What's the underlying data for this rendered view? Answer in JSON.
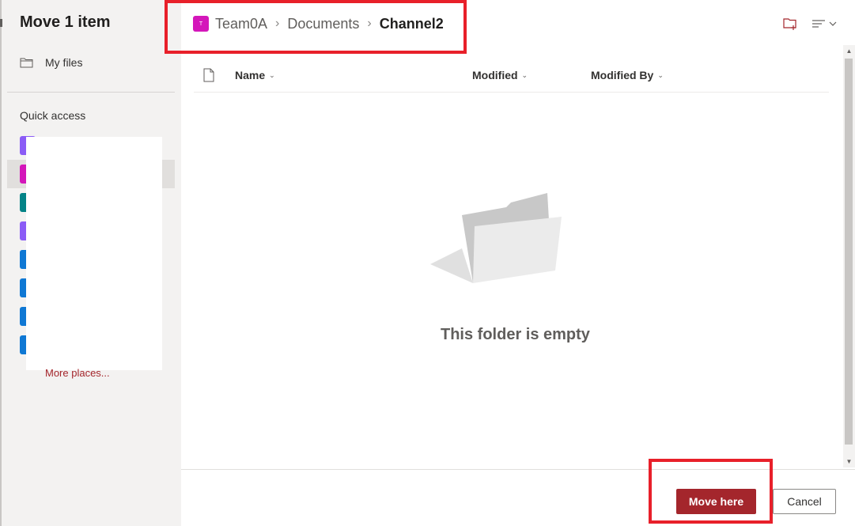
{
  "panel": {
    "title": "Move 1 item"
  },
  "sidebar": {
    "my_files_label": "My files",
    "quick_access_heading": "Quick access",
    "quick_access_items": [
      {
        "color": "#8b5cf6"
      },
      {
        "color": "#d417ba",
        "selected": true
      },
      {
        "color": "#038387"
      },
      {
        "color": "#8b5cf6"
      },
      {
        "color": "#0f78d4"
      },
      {
        "color": "#0f78d4"
      },
      {
        "color": "#0f78d4"
      },
      {
        "color": "#0f78d4"
      }
    ],
    "more_places_label": "More places..."
  },
  "breadcrumb": {
    "site_badge": "T",
    "site": "Team0A",
    "library": "Documents",
    "current": "Channel2"
  },
  "columns": {
    "name": "Name",
    "modified": "Modified",
    "modified_by": "Modified By"
  },
  "empty_state": {
    "message": "This folder is empty"
  },
  "actions": {
    "primary": "Move here",
    "secondary": "Cancel"
  },
  "colors": {
    "accent": "#a4262c",
    "highlight": "#e8202a",
    "site_badge": "#d417ba"
  }
}
